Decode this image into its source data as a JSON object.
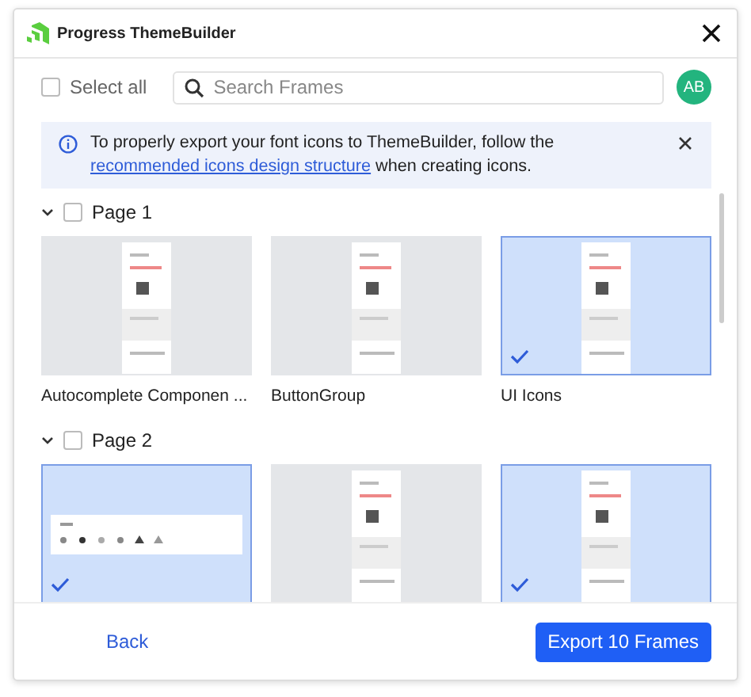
{
  "window": {
    "title": "Progress ThemeBuilder"
  },
  "toolbar": {
    "select_all": {
      "label": "Select all",
      "checked": false
    },
    "search": {
      "placeholder": "Search Frames"
    },
    "avatar": "AB"
  },
  "banner": {
    "text_before": "To properly export your font icons to ThemeBuilder, follow the ",
    "link": "recommended icons design structure",
    "text_after": " when creating icons."
  },
  "pages": [
    {
      "label": "Page 1",
      "checked": false,
      "expanded": true,
      "frames": [
        {
          "name": "Autocomplete Componen ...",
          "selected": false
        },
        {
          "name": "ButtonGroup",
          "selected": false
        },
        {
          "name": "UI Icons",
          "selected": true
        }
      ]
    },
    {
      "label": "Page 2",
      "checked": false,
      "expanded": true,
      "frames": [
        {
          "selected": true
        },
        {
          "selected": false
        },
        {
          "selected": true
        }
      ]
    }
  ],
  "footer": {
    "back": "Back",
    "export": "Export 10 Frames"
  }
}
